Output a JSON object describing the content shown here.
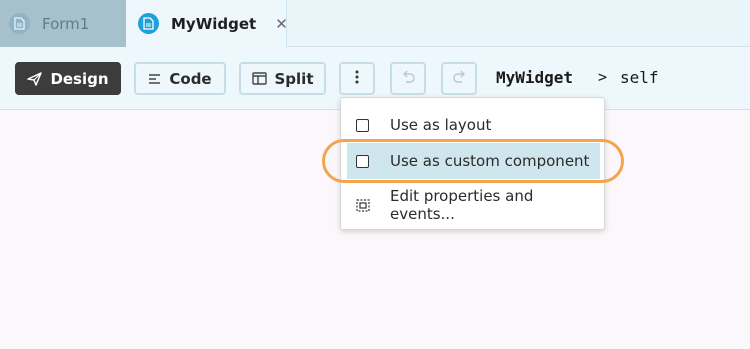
{
  "tabs": [
    {
      "label": "Form1",
      "icon": "form-file-icon",
      "active": false
    },
    {
      "label": "MyWidget",
      "icon": "form-file-icon",
      "active": true
    }
  ],
  "toolbar": {
    "design_label": "Design",
    "code_label": "Code",
    "split_label": "Split",
    "breadcrumb": {
      "component": "MyWidget",
      "separator": ">",
      "member": "self"
    }
  },
  "menu": {
    "items": [
      {
        "label": "Use as layout",
        "icon": "checkbox-icon",
        "highlighted": false
      },
      {
        "label": "Use as custom component",
        "icon": "checkbox-icon",
        "highlighted": true
      },
      {
        "label": "Edit properties and events...",
        "icon": "edit-properties-icon",
        "highlighted": false
      }
    ]
  },
  "colors": {
    "accent": "#1ea0dd",
    "highlight_ring": "#f3a44d",
    "design_button": "#3c3c3c",
    "menu_highlight": "#cfe6ee"
  }
}
